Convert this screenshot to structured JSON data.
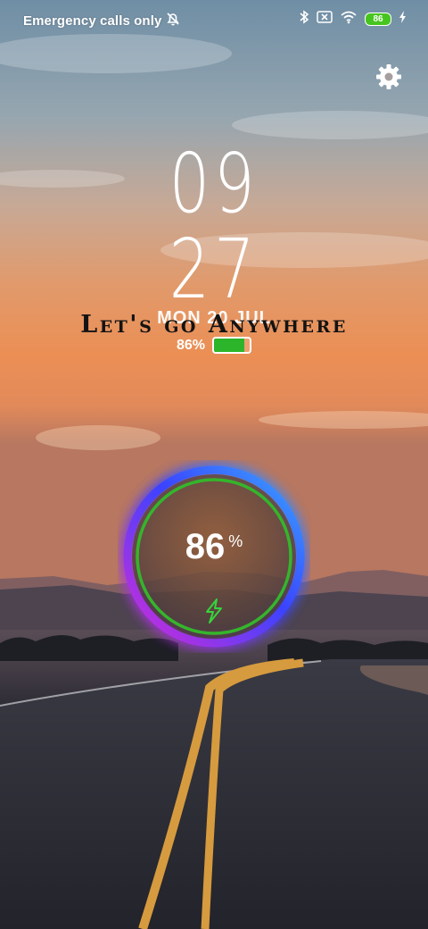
{
  "status_bar": {
    "carrier_text": "Emergency calls only",
    "battery_level": "86",
    "icons": [
      "silent-alarm-icon",
      "bluetooth-icon",
      "sim-error-icon",
      "wifi-icon",
      "battery-icon",
      "charging-bolt-icon"
    ]
  },
  "settings": {
    "icon": "gear-icon"
  },
  "clock": {
    "hours": "09",
    "minutes": "27"
  },
  "date": "MON 20 JUL",
  "motto": "Let's go Anywhere",
  "battery": {
    "percent_label": "86%",
    "level": 0.86,
    "fill_color": "#2cb52a"
  },
  "charging": {
    "value": "86",
    "unit": "%",
    "icon": "charging-bolt-icon",
    "ring_color": "#35b52b"
  },
  "colors": {
    "accent_green": "#47c51f",
    "glow_blue": "#2a5bff",
    "glow_magenta": "#c52bd9"
  }
}
